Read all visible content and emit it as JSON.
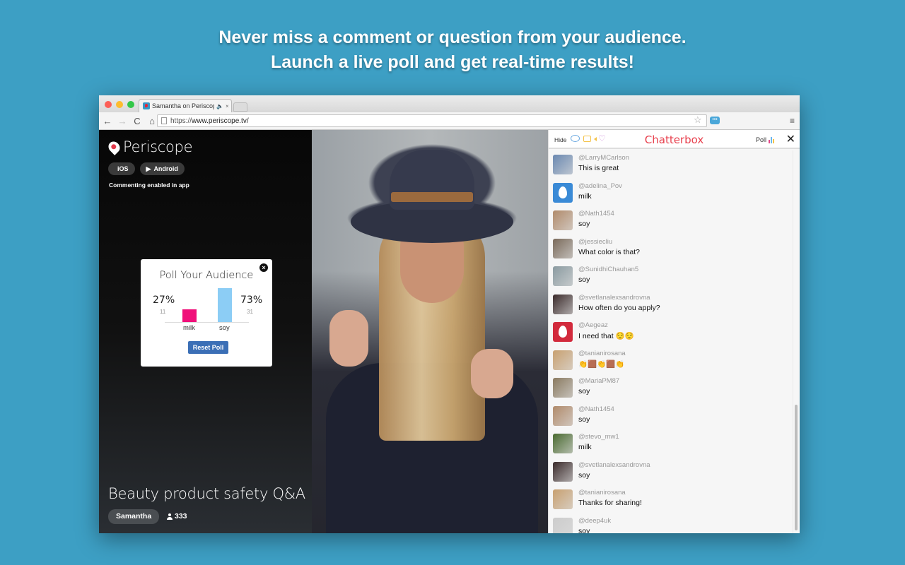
{
  "headline": {
    "line1": "Never miss a comment or question from your audience.",
    "line2": "Launch a live poll and get real-time results!"
  },
  "browser": {
    "tab_title": "Samantha on Periscope",
    "tab_audio_icon": "speaker-icon",
    "tab_close": "×",
    "url_scheme": "https://",
    "url_host": "www.periscope.tv/",
    "back": "←",
    "forward": "→",
    "reload": "C",
    "home": "⌂",
    "bookmark": "☆",
    "menu": "≡"
  },
  "sidebar": {
    "brand": "Periscope",
    "store_buttons": [
      {
        "icon": "apple-icon",
        "glyph": "",
        "label": "iOS"
      },
      {
        "icon": "play-icon",
        "glyph": "▶",
        "label": "Android"
      }
    ],
    "comment_note": "Commenting enabled in app",
    "stream_title": "Beauty product safety Q&A",
    "broadcaster": "Samantha",
    "viewer_count": "333"
  },
  "poll": {
    "title": "Poll Your Audience",
    "close": "×",
    "options": [
      {
        "label": "milk",
        "percent": "27%",
        "count": "11",
        "value": 27,
        "color": "#f0117a"
      },
      {
        "label": "soy",
        "percent": "73%",
        "count": "31",
        "value": 73,
        "color": "#8ccdf5"
      }
    ],
    "reset_label": "Reset Poll"
  },
  "chat": {
    "hide_label": "Hide",
    "title": "Chatterbox",
    "poll_label": "Poll",
    "close": "✕",
    "brand_color": "#e8414e",
    "messages": [
      {
        "user": "@LarryMCarlson",
        "text": "This is great",
        "avatar": "photo",
        "color": "#6a88b0"
      },
      {
        "user": "@adelina_Pov",
        "text": "milk",
        "avatar": "egg-blue",
        "color": ""
      },
      {
        "user": "@Nath1454",
        "text": "soy",
        "avatar": "photo",
        "color": "#b08a6a"
      },
      {
        "user": "@jessiecliu",
        "text": "What color is that?",
        "avatar": "photo",
        "color": "#7a6a5a"
      },
      {
        "user": "@SunidhiChauhan5",
        "text": "soy",
        "avatar": "photo",
        "color": "#8a9aa0"
      },
      {
        "user": "@svetlanalexsandrovna",
        "text": "How often do you apply?",
        "avatar": "photo",
        "color": "#3a2a2a"
      },
      {
        "user": "@Aegeaz",
        "text": "I need that 😌😌",
        "avatar": "egg-red",
        "color": ""
      },
      {
        "user": "@tanianirosana",
        "text": "👏🟫👏🟫👏",
        "avatar": "photo",
        "color": "#c8a070"
      },
      {
        "user": "@MariaPM87",
        "text": "soy",
        "avatar": "photo",
        "color": "#8a7a60"
      },
      {
        "user": "@Nath1454",
        "text": "soy",
        "avatar": "photo",
        "color": "#b08a6a"
      },
      {
        "user": "@stevo_mw1",
        "text": "milk",
        "avatar": "photo",
        "color": "#4a6a30"
      },
      {
        "user": "@svetlanalexsandrovna",
        "text": "soy",
        "avatar": "photo",
        "color": "#3a2a2a"
      },
      {
        "user": "@tanianirosana",
        "text": "Thanks for sharing!",
        "avatar": "photo",
        "color": "#c8a070"
      },
      {
        "user": "@deep4uk",
        "text": "soy",
        "avatar": "photo",
        "color": "#cccccc"
      }
    ]
  }
}
